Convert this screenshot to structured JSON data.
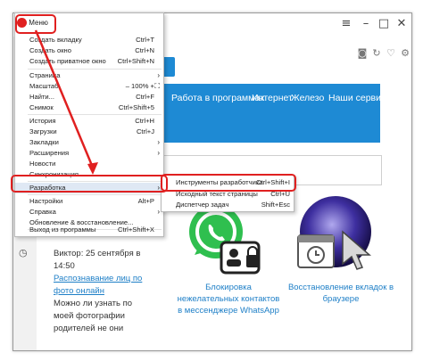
{
  "menu": {
    "title": "Меню",
    "items": [
      {
        "label": "Создать вкладку",
        "shortcut": "Ctrl+T"
      },
      {
        "label": "Создать окно",
        "shortcut": "Ctrl+N"
      },
      {
        "label": "Создать приватное окно",
        "shortcut": "Ctrl+Shift+N"
      },
      {
        "label": "Страница",
        "shortcut": ""
      },
      {
        "label": "Масштаб",
        "shortcut": "– 100% +"
      },
      {
        "label": "Найти...",
        "shortcut": "Ctrl+F"
      },
      {
        "label": "Снимок",
        "shortcut": "Ctrl+Shift+5"
      },
      {
        "label": "История",
        "shortcut": "Ctrl+H"
      },
      {
        "label": "Загрузки",
        "shortcut": "Ctrl+J"
      },
      {
        "label": "Закладки",
        "shortcut": ""
      },
      {
        "label": "Расширения",
        "shortcut": ""
      },
      {
        "label": "Новости",
        "shortcut": ""
      },
      {
        "label": "Синхронизация...",
        "shortcut": ""
      },
      {
        "label": "Разработка",
        "shortcut": ""
      },
      {
        "label": "Настройки",
        "shortcut": "Alt+P"
      },
      {
        "label": "Справка",
        "shortcut": ""
      },
      {
        "label": "Обновление & восстановление...",
        "shortcut": ""
      },
      {
        "label": "Выход из программы",
        "shortcut": "Ctrl+Shift+X"
      }
    ]
  },
  "submenu": {
    "items": [
      {
        "label": "Инструменты разработчика",
        "shortcut": "Ctrl+Shift+I"
      },
      {
        "label": "Исходный текст страницы",
        "shortcut": "Ctrl+U"
      },
      {
        "label": "Диспетчер задач",
        "shortcut": "Shift+Esc"
      }
    ]
  },
  "nav": {
    "items": [
      "Работа в программах",
      "Интернет",
      "Железо",
      "Наши сервисы"
    ]
  },
  "article": {
    "author": "Виктор: 25 сентября в 14:50",
    "link": "Распознавание лиц по фото онлайн",
    "text1": "Можно ли узнать по",
    "text2": "моей фотографии",
    "text3": "родителей не они"
  },
  "cards": [
    {
      "caption": "Блокировка нежелательных контактов в мессенджере WhatsApp"
    },
    {
      "caption": "Восстановление вкладок в браузере"
    }
  ],
  "colors": {
    "accent": "#1e8ad4",
    "highlight": "#e02020",
    "whatsapp": "#2fbf4f"
  }
}
